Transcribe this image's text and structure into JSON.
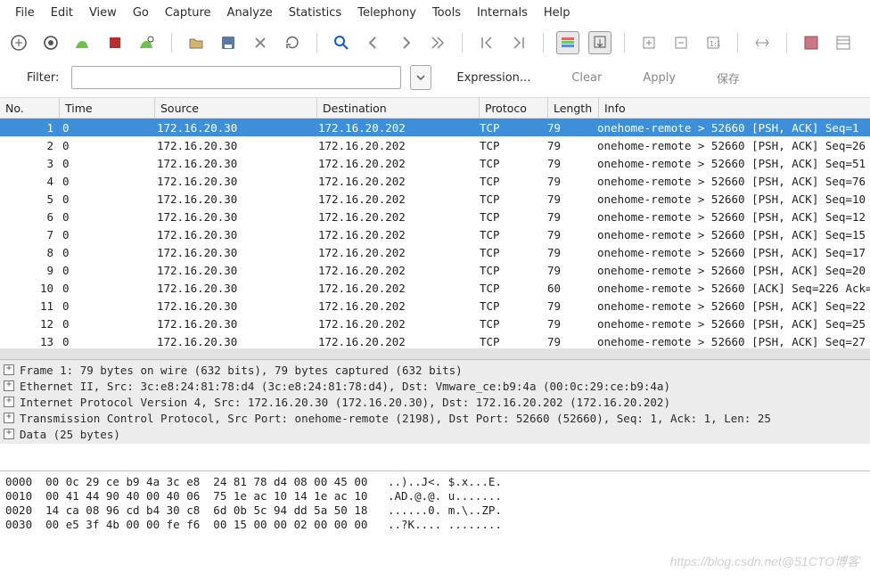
{
  "menu": [
    "File",
    "Edit",
    "View",
    "Go",
    "Capture",
    "Analyze",
    "Statistics",
    "Telephony",
    "Tools",
    "Internals",
    "Help"
  ],
  "filter": {
    "label": "Filter:",
    "value": "",
    "expression": "Expression...",
    "clear": "Clear",
    "apply": "Apply",
    "save": "保存"
  },
  "columns": {
    "no": "No.",
    "time": "Time",
    "source": "Source",
    "destination": "Destination",
    "protocol": "Protoco",
    "length": "Length",
    "info": "Info"
  },
  "packets": [
    {
      "no": "1",
      "time": "0",
      "src": "172.16.20.30",
      "dst": "172.16.20.202",
      "proto": "TCP",
      "len": "79",
      "info": "onehome-remote > 52660 [PSH, ACK] Seq=1 "
    },
    {
      "no": "2",
      "time": "0",
      "src": "172.16.20.30",
      "dst": "172.16.20.202",
      "proto": "TCP",
      "len": "79",
      "info": "onehome-remote > 52660 [PSH, ACK] Seq=26"
    },
    {
      "no": "3",
      "time": "0",
      "src": "172.16.20.30",
      "dst": "172.16.20.202",
      "proto": "TCP",
      "len": "79",
      "info": "onehome-remote > 52660 [PSH, ACK] Seq=51"
    },
    {
      "no": "4",
      "time": "0",
      "src": "172.16.20.30",
      "dst": "172.16.20.202",
      "proto": "TCP",
      "len": "79",
      "info": "onehome-remote > 52660 [PSH, ACK] Seq=76"
    },
    {
      "no": "5",
      "time": "0",
      "src": "172.16.20.30",
      "dst": "172.16.20.202",
      "proto": "TCP",
      "len": "79",
      "info": "onehome-remote > 52660 [PSH, ACK] Seq=10"
    },
    {
      "no": "6",
      "time": "0",
      "src": "172.16.20.30",
      "dst": "172.16.20.202",
      "proto": "TCP",
      "len": "79",
      "info": "onehome-remote > 52660 [PSH, ACK] Seq=12"
    },
    {
      "no": "7",
      "time": "0",
      "src": "172.16.20.30",
      "dst": "172.16.20.202",
      "proto": "TCP",
      "len": "79",
      "info": "onehome-remote > 52660 [PSH, ACK] Seq=15"
    },
    {
      "no": "8",
      "time": "0",
      "src": "172.16.20.30",
      "dst": "172.16.20.202",
      "proto": "TCP",
      "len": "79",
      "info": "onehome-remote > 52660 [PSH, ACK] Seq=17"
    },
    {
      "no": "9",
      "time": "0",
      "src": "172.16.20.30",
      "dst": "172.16.20.202",
      "proto": "TCP",
      "len": "79",
      "info": "onehome-remote > 52660 [PSH, ACK] Seq=20"
    },
    {
      "no": "10",
      "time": "0",
      "src": "172.16.20.30",
      "dst": "172.16.20.202",
      "proto": "TCP",
      "len": "60",
      "info": "onehome-remote > 52660 [ACK] Seq=226 Ack="
    },
    {
      "no": "11",
      "time": "0",
      "src": "172.16.20.30",
      "dst": "172.16.20.202",
      "proto": "TCP",
      "len": "79",
      "info": "onehome-remote > 52660 [PSH, ACK] Seq=22"
    },
    {
      "no": "12",
      "time": "0",
      "src": "172.16.20.30",
      "dst": "172.16.20.202",
      "proto": "TCP",
      "len": "79",
      "info": "onehome-remote > 52660 [PSH, ACK] Seq=25"
    },
    {
      "no": "13",
      "time": "0",
      "src": "172.16.20.30",
      "dst": "172.16.20.202",
      "proto": "TCP",
      "len": "79",
      "info": "onehome-remote > 52660 [PSH, ACK] Seq=27"
    }
  ],
  "details": [
    "Frame 1: 79 bytes on wire (632 bits), 79 bytes captured (632 bits)",
    "Ethernet II, Src: 3c:e8:24:81:78:d4 (3c:e8:24:81:78:d4), Dst: Vmware_ce:b9:4a (00:0c:29:ce:b9:4a)",
    "Internet Protocol Version 4, Src: 172.16.20.30 (172.16.20.30), Dst: 172.16.20.202 (172.16.20.202)",
    "Transmission Control Protocol, Src Port: onehome-remote (2198), Dst Port: 52660 (52660), Seq: 1, Ack: 1, Len: 25",
    "Data (25 bytes)"
  ],
  "hex": [
    {
      "off": "0000",
      "bytes": "00 0c 29 ce b9 4a 3c e8  24 81 78 d4 08 00 45 00",
      "ascii": "..)..J<. $.x...E."
    },
    {
      "off": "0010",
      "bytes": "00 41 44 90 40 00 40 06  75 1e ac 10 14 1e ac 10",
      "ascii": ".AD.@.@. u......."
    },
    {
      "off": "0020",
      "bytes": "14 ca 08 96 cd b4 30 c8  6d 0b 5c 94 dd 5a 50 18",
      "ascii": "......0. m.\\..ZP."
    },
    {
      "off": "0030",
      "bytes": "00 e5 3f 4b 00 00 fe f6  00 15 00 00 02 00 00 00",
      "ascii": "..?K.... ........"
    }
  ],
  "watermark": "https://blog.csdn.net@51CTO博客"
}
